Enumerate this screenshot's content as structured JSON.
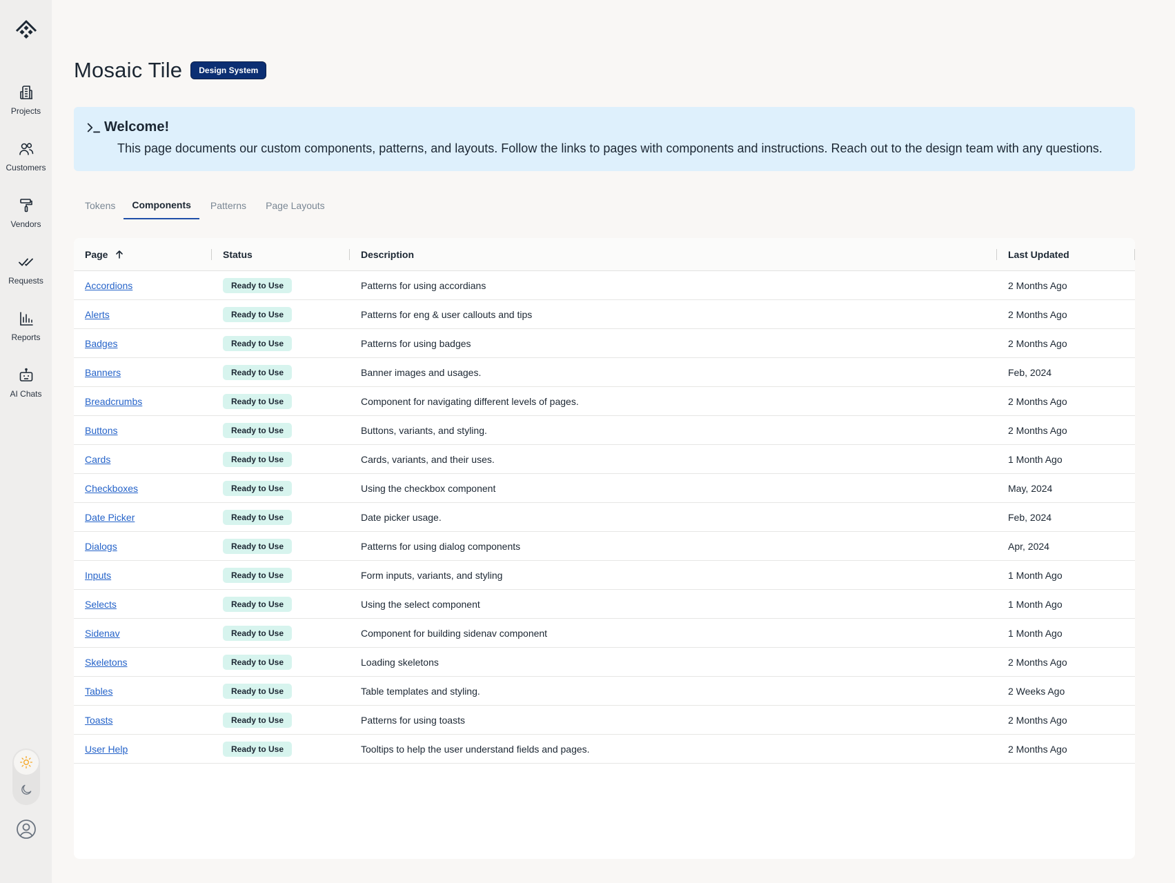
{
  "sidebar": {
    "logo_icon": "diamond-logo-icon",
    "items": [
      {
        "label": "Projects",
        "icon": "building-icon"
      },
      {
        "label": "Customers",
        "icon": "users-icon"
      },
      {
        "label": "Vendors",
        "icon": "paint-roller-icon"
      },
      {
        "label": "Requests",
        "icon": "double-check-icon"
      },
      {
        "label": "Reports",
        "icon": "bar-chart-icon"
      },
      {
        "label": "AI Chats",
        "icon": "robot-icon"
      }
    ],
    "theme": {
      "light_icon": "sun-icon",
      "dark_icon": "moon-icon",
      "active": "light"
    },
    "account_icon": "user-circle-icon"
  },
  "header": {
    "title": "Mosaic Tile",
    "badge": "Design System"
  },
  "welcome": {
    "icon": "terminal-prompt-icon",
    "title": "Welcome!",
    "text": "This page documents our custom components, patterns, and layouts. Follow the links to pages with components and instructions. Reach out to the design team with any questions."
  },
  "tabs": [
    {
      "label": "Tokens",
      "active": false
    },
    {
      "label": "Components",
      "active": true
    },
    {
      "label": "Patterns",
      "active": false
    },
    {
      "label": "Page Layouts",
      "active": false
    }
  ],
  "table": {
    "columns": {
      "page": "Page",
      "status": "Status",
      "description": "Description",
      "last_updated": "Last Updated"
    },
    "sort_icon": "arrow-up-icon",
    "rows": [
      {
        "page": "Accordions",
        "status": "Ready to Use",
        "description": "Patterns for using accordians",
        "updated": "2 Months Ago"
      },
      {
        "page": "Alerts",
        "status": "Ready to Use",
        "description": "Patterns for eng & user callouts and tips",
        "updated": "2 Months Ago"
      },
      {
        "page": "Badges",
        "status": "Ready to Use",
        "description": "Patterns for using badges",
        "updated": "2 Months Ago"
      },
      {
        "page": "Banners",
        "status": "Ready to Use",
        "description": "Banner images and usages.",
        "updated": "Feb, 2024"
      },
      {
        "page": "Breadcrumbs",
        "status": "Ready to Use",
        "description": "Component for navigating different levels of pages.",
        "updated": "2 Months Ago"
      },
      {
        "page": "Buttons",
        "status": "Ready to Use",
        "description": "Buttons, variants, and styling.",
        "updated": "2 Months Ago"
      },
      {
        "page": "Cards",
        "status": "Ready to Use",
        "description": "Cards, variants, and their uses.",
        "updated": "1 Month Ago"
      },
      {
        "page": "Checkboxes",
        "status": "Ready to Use",
        "description": "Using the checkbox component",
        "updated": "May, 2024"
      },
      {
        "page": "Date Picker",
        "status": "Ready to Use",
        "description": "Date picker usage.",
        "updated": "Feb, 2024"
      },
      {
        "page": "Dialogs",
        "status": "Ready to Use",
        "description": "Patterns for using dialog components",
        "updated": "Apr, 2024"
      },
      {
        "page": "Inputs",
        "status": "Ready to Use",
        "description": "Form inputs, variants, and styling",
        "updated": "1 Month Ago"
      },
      {
        "page": "Selects",
        "status": "Ready to Use",
        "description": "Using the select component",
        "updated": "1 Month Ago"
      },
      {
        "page": "Sidenav",
        "status": "Ready to Use",
        "description": "Component for building sidenav component",
        "updated": "1 Month Ago"
      },
      {
        "page": "Skeletons",
        "status": "Ready to Use",
        "description": "Loading skeletons",
        "updated": "2 Months Ago"
      },
      {
        "page": "Tables",
        "status": "Ready to Use",
        "description": "Table templates and styling.",
        "updated": "2 Weeks Ago"
      },
      {
        "page": "Toasts",
        "status": "Ready to Use",
        "description": "Patterns for using toasts",
        "updated": "2 Months Ago"
      },
      {
        "page": "User Help",
        "status": "Ready to Use",
        "description": "Tooltips to help the user understand fields and pages.",
        "updated": "2 Months Ago"
      }
    ]
  },
  "colors": {
    "accent": "#1e4ea8",
    "badge_bg": "#0c2f73",
    "status_bg": "#d7f4ee",
    "welcome_bg": "#def0fc",
    "link": "#2563c9",
    "sun": "#f5a623"
  }
}
